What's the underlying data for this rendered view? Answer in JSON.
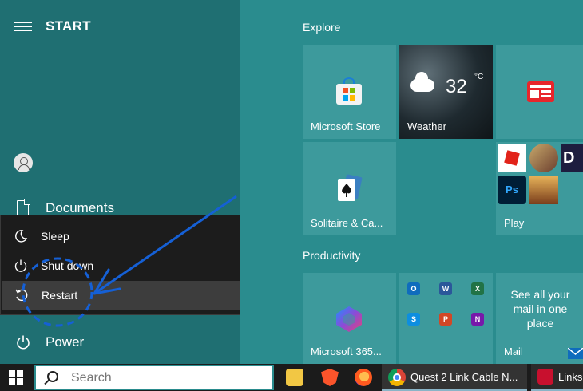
{
  "start_menu": {
    "title": "START",
    "menu_icon": "hamburger-icon",
    "user_icon": "user-avatar-icon",
    "documents_label": "Documents",
    "power_label": "Power"
  },
  "power_flyout": {
    "items": [
      {
        "label": "Sleep",
        "icon": "moon-icon"
      },
      {
        "label": "Shut down",
        "icon": "power-icon"
      },
      {
        "label": "Restart",
        "icon": "restart-icon",
        "highlighted": true
      }
    ]
  },
  "explore": {
    "title": "Explore",
    "tiles": {
      "store": "Microsoft Store",
      "weather_label": "Weather",
      "weather_temp": "32",
      "weather_unit": "°C",
      "solitaire": "Solitaire & Ca...",
      "play": "Play"
    }
  },
  "productivity": {
    "title": "Productivity",
    "tiles": {
      "office": "Microsoft 365...",
      "mail_text": "See all your mail in one place",
      "mail_label": "Mail"
    },
    "mini_apps": [
      {
        "icon": "outlook-icon",
        "letter": "O",
        "color": "#0f6cbd"
      },
      {
        "icon": "word-icon",
        "letter": "W",
        "color": "#2b579a"
      },
      {
        "icon": "excel-icon",
        "letter": "X",
        "color": "#217346"
      },
      {
        "icon": "skype-icon",
        "letter": "S",
        "color": "#0d8ee0"
      },
      {
        "icon": "powerpoint-icon",
        "letter": "P",
        "color": "#d24726"
      },
      {
        "icon": "onenote-icon",
        "letter": "N",
        "color": "#7719aa"
      }
    ]
  },
  "taskbar": {
    "search_placeholder": "Search",
    "tasks": [
      {
        "label": "Quest 2 Link Cable N...",
        "icon": "chrome-icon"
      },
      {
        "label": "Links",
        "icon": "app-icon"
      }
    ]
  },
  "colors": {
    "annotation": "#1560d6"
  }
}
